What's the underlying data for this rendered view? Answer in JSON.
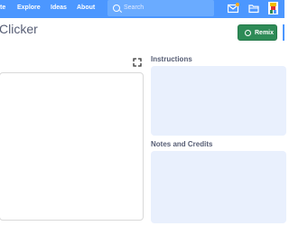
{
  "menubar": {
    "items": [
      "te",
      "Explore",
      "Ideas",
      "About"
    ],
    "search_placeholder": "Search"
  },
  "icons": {
    "messages": "mail-icon",
    "mystuff": "folder-icon",
    "account": "avatar"
  },
  "project": {
    "title": "Clicker",
    "remix_label": "Remix",
    "instructions_label": "Instructions",
    "notes_label": "Notes and Credits"
  },
  "colors": {
    "accent": "#4c97ff",
    "remix": "#2e8b57",
    "panel": "#e9f0fd"
  }
}
